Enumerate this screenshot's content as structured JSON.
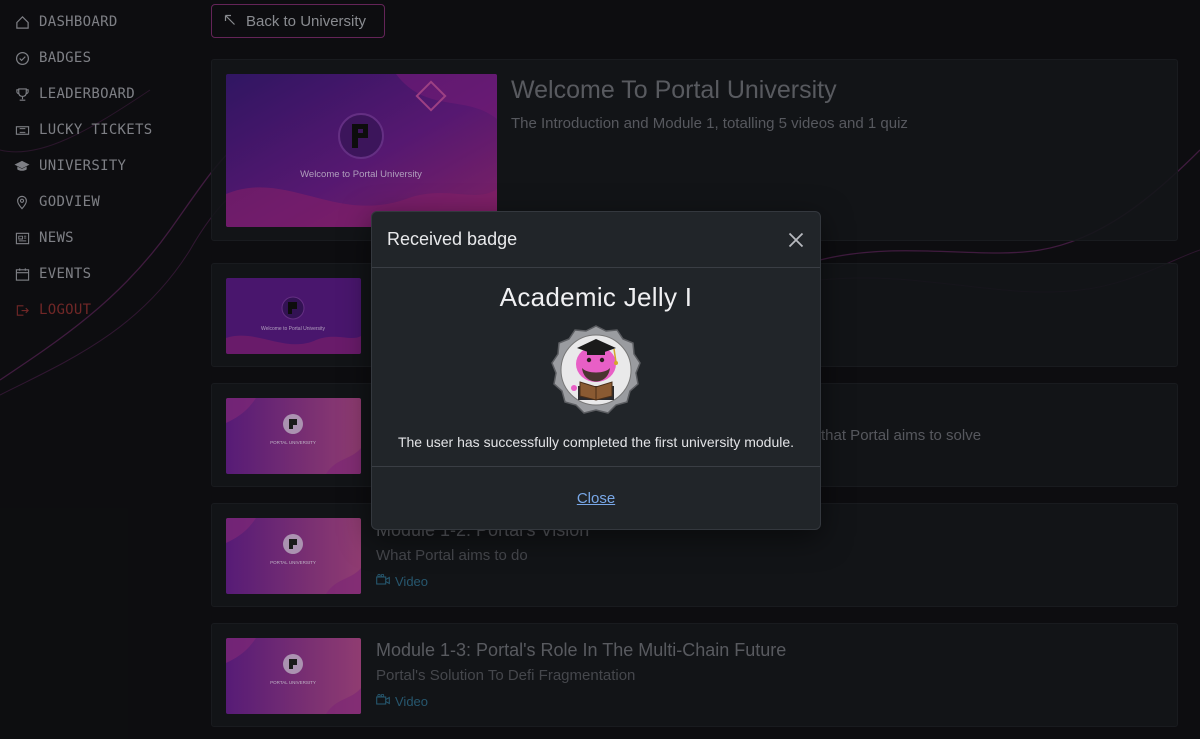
{
  "sidebar": {
    "items": [
      {
        "label": "DASHBOARD",
        "icon": "home-icon"
      },
      {
        "label": "BADGES",
        "icon": "check-circle-icon"
      },
      {
        "label": "LEADERBOARD",
        "icon": "trophy-icon"
      },
      {
        "label": "LUCKY TICKETS",
        "icon": "ticket-icon"
      },
      {
        "label": "UNIVERSITY",
        "icon": "graduation-cap-icon"
      },
      {
        "label": "GODVIEW",
        "icon": "map-pin-icon"
      },
      {
        "label": "NEWS",
        "icon": "newspaper-icon"
      },
      {
        "label": "EVENTS",
        "icon": "calendar-icon"
      },
      {
        "label": "LOGOUT",
        "icon": "logout-icon"
      }
    ]
  },
  "back_button": {
    "label": "Back to University",
    "icon": "arrow-up-left-icon"
  },
  "course": {
    "title": "Welcome To Portal University",
    "subtitle": "The Introduction and Module 1, totalling 5 videos and 1 quiz",
    "thumb_text": "Welcome to Portal University"
  },
  "lessons": [
    {
      "title": "",
      "subtitle": "",
      "tag": "",
      "thumb_text": "Welcome to Portal University"
    },
    {
      "title": "",
      "subtitle": "that Portal aims to solve",
      "tag": "",
      "thumb_text": "PORTAL UNIVERSITY"
    },
    {
      "title": "Module 1-2: Portal's Vision",
      "subtitle": "What Portal aims to do",
      "tag": "Video",
      "thumb_text": "PORTAL UNIVERSITY"
    },
    {
      "title": "Module 1-3: Portal's Role In The Multi-Chain Future",
      "subtitle": "Portal's Solution To Defi Fragmentation",
      "tag": "Video",
      "thumb_text": "PORTAL UNIVERSITY"
    }
  ],
  "modal": {
    "title": "Received badge",
    "badge_name": "Academic Jelly I",
    "description": "The user has successfully completed the first university module.",
    "close_label": "Close"
  },
  "colors": {
    "background": "#101114",
    "accent": "#7a2c6c",
    "link": "#79a8e8",
    "logout": "#8a3030",
    "badge_pink": "#e85fc6"
  }
}
